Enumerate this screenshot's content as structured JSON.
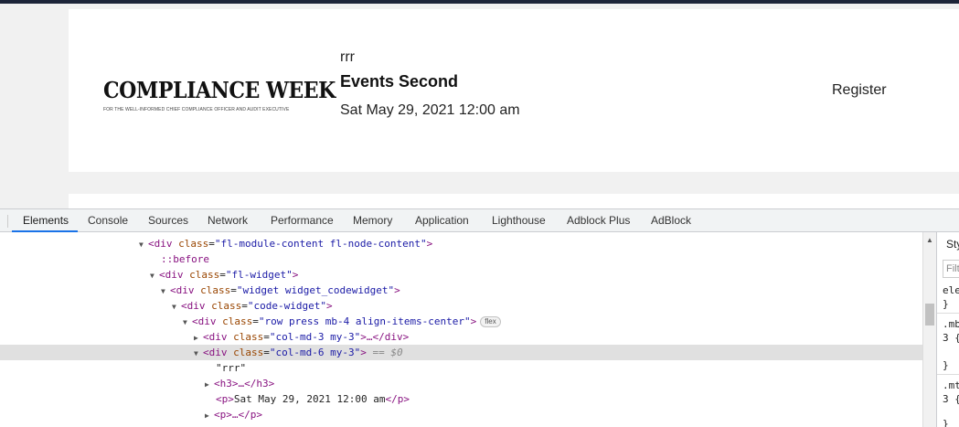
{
  "page": {
    "logo": {
      "title": "COMPLIANCE WEEK",
      "tagline": "FOR THE WELL-INFORMED CHIEF COMPLIANCE OFFICER AND AUDIT EXECUTIVE"
    },
    "event": {
      "pretitle": "rrr",
      "title": "Events Second",
      "date": "Sat May 29, 2021 12:00 am"
    },
    "register_label": "Register"
  },
  "devtools": {
    "tabs": [
      "Elements",
      "Console",
      "Sources",
      "Network",
      "Performance",
      "Memory",
      "Application",
      "Lighthouse",
      "Adblock Plus",
      "AdBlock"
    ],
    "active_tab": "Elements",
    "dom": {
      "l1": {
        "tag_open": "<div",
        "attr": "class",
        "val": "\"fl-module-content fl-node-content\"",
        "tag_close": ">"
      },
      "l2": {
        "pseudo": "::before"
      },
      "l3": {
        "tag_open": "<div",
        "attr": "class",
        "val": "\"fl-widget\"",
        "tag_close": ">"
      },
      "l4": {
        "tag_open": "<div",
        "attr": "class",
        "val": "\"widget widget_codewidget\"",
        "tag_close": ">"
      },
      "l5": {
        "tag_open": "<div",
        "attr": "class",
        "val": "\"code-widget\"",
        "tag_close": ">"
      },
      "l6": {
        "tag_open": "<div",
        "attr": "class",
        "val": "\"row press mb-4 align-items-center\"",
        "tag_close": ">",
        "badge": "flex"
      },
      "l7": {
        "tag_open": "<div",
        "attr": "class",
        "val": "\"col-md-3 my-3\"",
        "tag_close": ">…</div>"
      },
      "l8": {
        "tag_open": "<div",
        "attr": "class",
        "val": "\"col-md-6 my-3\"",
        "tag_close": ">",
        "marker": "== $0"
      },
      "l9": {
        "text": "\"rrr\""
      },
      "l10": {
        "tag": "<h3>…</h3>"
      },
      "l11": {
        "tag_open": "<p>",
        "text": "Sat May 29, 2021 12:00 am",
        "tag_close": "</p>"
      },
      "l12": {
        "tag": "<p>…</p>"
      }
    },
    "styles": {
      "tab": "Styles",
      "filter_placeholder": "Filter",
      "lines": [
        "ele",
        "}",
        ".mb",
        "3 {",
        "}",
        ".mt",
        "3 {",
        "}"
      ]
    }
  }
}
